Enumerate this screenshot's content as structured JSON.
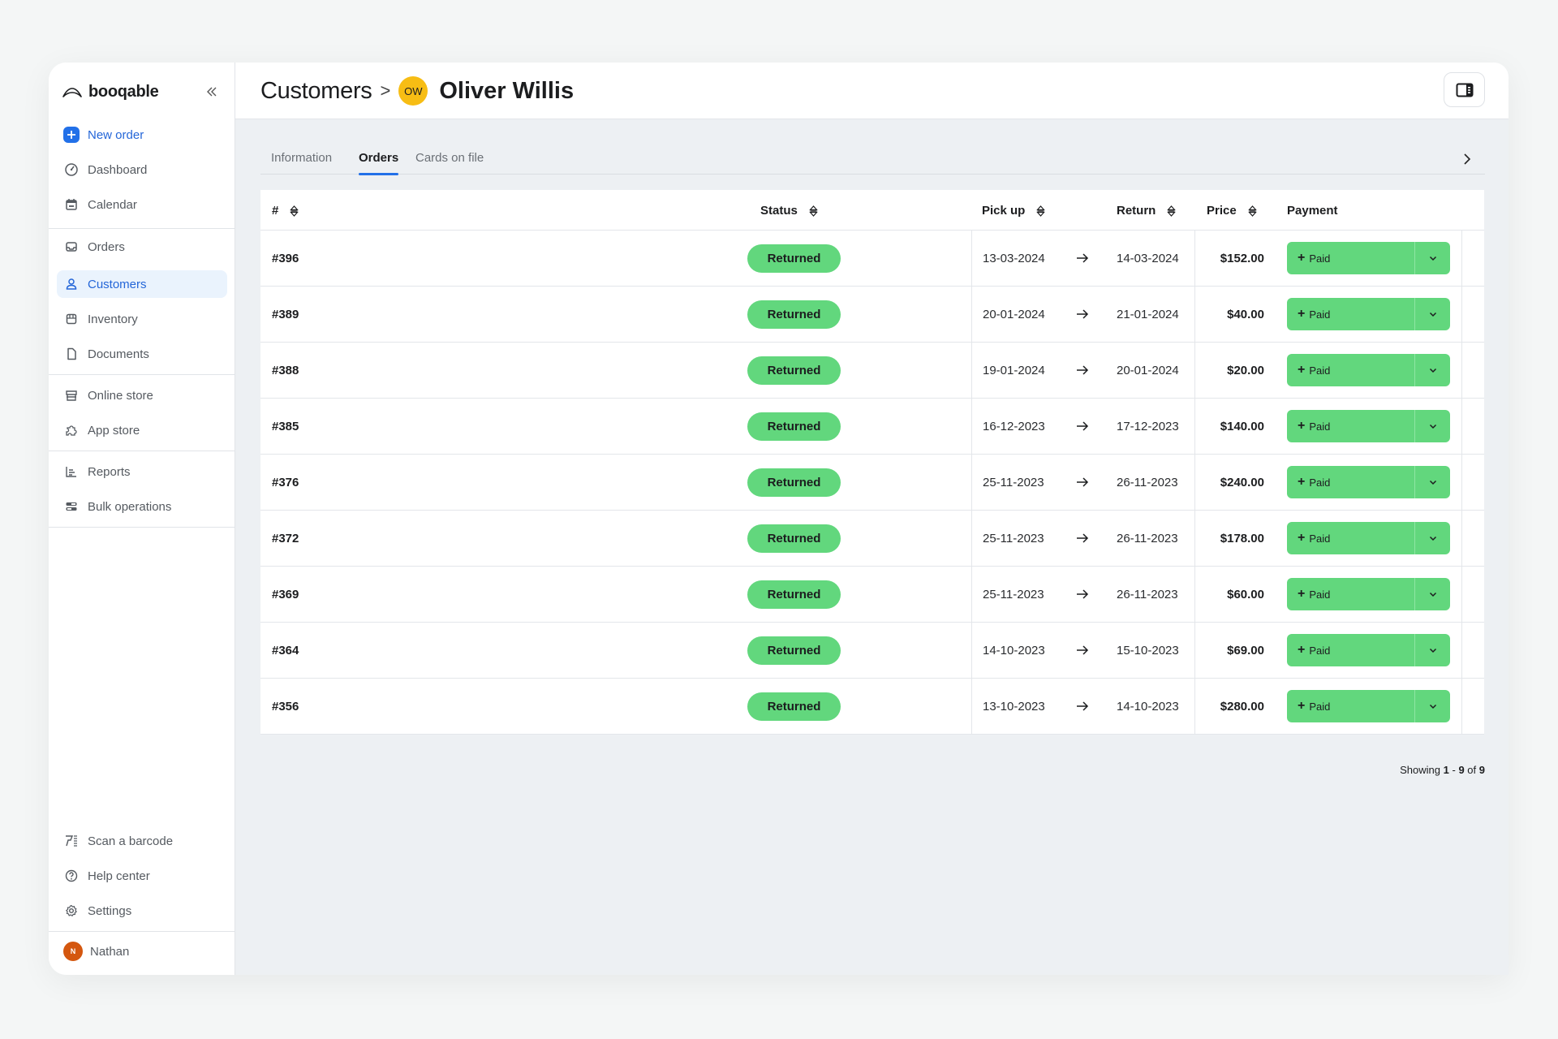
{
  "sidebar": {
    "brand": "booqable",
    "new_order": "New order",
    "items": [
      {
        "label": "Dashboard",
        "icon": "dashboard-icon"
      },
      {
        "label": "Calendar",
        "icon": "calendar-icon"
      },
      {
        "label": "Orders",
        "icon": "inbox-icon"
      },
      {
        "label": "Customers",
        "icon": "user-icon",
        "active": true
      },
      {
        "label": "Inventory",
        "icon": "box-icon"
      },
      {
        "label": "Documents",
        "icon": "document-icon"
      },
      {
        "label": "Online store",
        "icon": "store-icon"
      },
      {
        "label": "App store",
        "icon": "puzzle-icon"
      },
      {
        "label": "Reports",
        "icon": "chart-icon"
      },
      {
        "label": "Bulk operations",
        "icon": "bulk-icon"
      }
    ],
    "bottom_items": [
      {
        "label": "Scan a barcode",
        "icon": "barcode-scanner-icon"
      },
      {
        "label": "Help center",
        "icon": "help-icon"
      },
      {
        "label": "Settings",
        "icon": "gear-icon"
      }
    ],
    "user": {
      "name": "Nathan",
      "initial": "N",
      "color": "#d4570f"
    }
  },
  "header": {
    "breadcrumb_parent": "Customers",
    "separator": ">",
    "customer_initials": "OW",
    "customer_name": "Oliver Willis",
    "avatar_color": "#f7bd14"
  },
  "tabs": [
    {
      "label": "Information"
    },
    {
      "label": "Orders",
      "active": true
    },
    {
      "label": "Cards on file"
    }
  ],
  "table": {
    "columns": {
      "number": "#",
      "status": "Status",
      "pickup": "Pick up",
      "return": "Return",
      "price": "Price",
      "payment": "Payment"
    },
    "rows": [
      {
        "number": "#396",
        "status": "Returned",
        "pickup": "13-03-2024",
        "return": "14-03-2024",
        "price": "$152.00",
        "payment": "Paid"
      },
      {
        "number": "#389",
        "status": "Returned",
        "pickup": "20-01-2024",
        "return": "21-01-2024",
        "price": "$40.00",
        "payment": "Paid"
      },
      {
        "number": "#388",
        "status": "Returned",
        "pickup": "19-01-2024",
        "return": "20-01-2024",
        "price": "$20.00",
        "payment": "Paid"
      },
      {
        "number": "#385",
        "status": "Returned",
        "pickup": "16-12-2023",
        "return": "17-12-2023",
        "price": "$140.00",
        "payment": "Paid"
      },
      {
        "number": "#376",
        "status": "Returned",
        "pickup": "25-11-2023",
        "return": "26-11-2023",
        "price": "$240.00",
        "payment": "Paid"
      },
      {
        "number": "#372",
        "status": "Returned",
        "pickup": "25-11-2023",
        "return": "26-11-2023",
        "price": "$178.00",
        "payment": "Paid"
      },
      {
        "number": "#369",
        "status": "Returned",
        "pickup": "25-11-2023",
        "return": "26-11-2023",
        "price": "$60.00",
        "payment": "Paid"
      },
      {
        "number": "#364",
        "status": "Returned",
        "pickup": "14-10-2023",
        "return": "15-10-2023",
        "price": "$69.00",
        "payment": "Paid"
      },
      {
        "number": "#356",
        "status": "Returned",
        "pickup": "13-10-2023",
        "return": "14-10-2023",
        "price": "$280.00",
        "payment": "Paid"
      }
    ],
    "status_color": "#62d77d"
  },
  "pagination": {
    "prefix": "Showing",
    "from": "1",
    "dash": "-",
    "to": "9",
    "of": "of",
    "total": "9"
  },
  "colors": {
    "accent": "#2270e8",
    "success": "#62d77d"
  }
}
